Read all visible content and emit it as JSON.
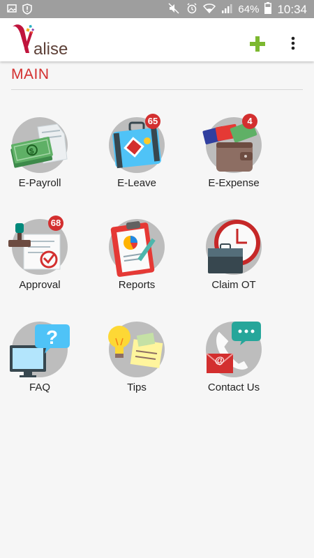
{
  "status_bar": {
    "battery": "64%",
    "time": "10:34"
  },
  "app": {
    "logo_text": "alise"
  },
  "section": {
    "title": "MAIN"
  },
  "tiles": [
    {
      "label": "E-Payroll"
    },
    {
      "label": "E-Leave",
      "badge": "65"
    },
    {
      "label": "E-Expense",
      "badge": "4"
    },
    {
      "label": "Approval",
      "badge": "68"
    },
    {
      "label": "Reports"
    },
    {
      "label": "Claim OT"
    },
    {
      "label": "FAQ"
    },
    {
      "label": "Tips"
    },
    {
      "label": "Contact Us"
    }
  ],
  "colors": {
    "accent": "#d32f2f",
    "add": "#7cb82f",
    "status_bar": "#9e9e9e"
  }
}
